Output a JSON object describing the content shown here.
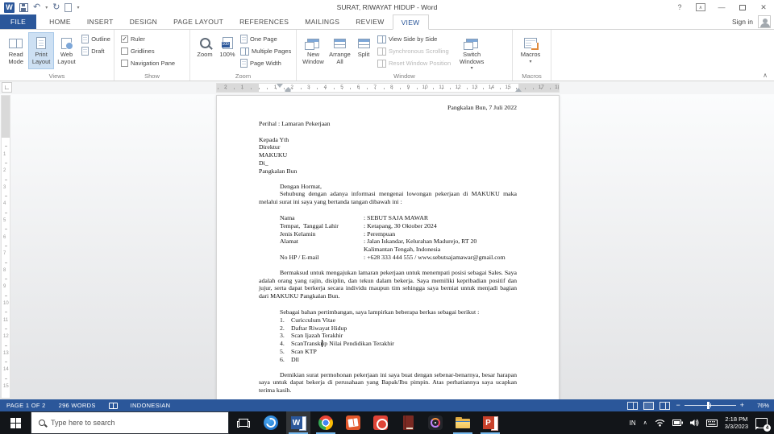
{
  "title_bar": {
    "title": "SURAT, RIWAYAT HIDUP - Word",
    "sign_in": "Sign in"
  },
  "icons": {
    "word_logo": "W",
    "undo": "↶",
    "redo": "↻",
    "qat_dropdown": "▾",
    "help": "?",
    "minimize": "—",
    "close": "✕",
    "check": "✓",
    "dropdown": "▾",
    "collapse_ribbon": "∧",
    "tab_stop": "∟",
    "tray_chevron": "∧"
  },
  "tabs": {
    "items": [
      "FILE",
      "HOME",
      "INSERT",
      "DESIGN",
      "PAGE LAYOUT",
      "REFERENCES",
      "MAILINGS",
      "REVIEW",
      "VIEW"
    ],
    "active": "VIEW"
  },
  "ribbon": {
    "views": {
      "label": "Views",
      "read_mode": "Read Mode",
      "print_layout": "Print Layout",
      "web_layout": "Web Layout",
      "outline": "Outline",
      "draft": "Draft",
      "selected": "Print Layout"
    },
    "show": {
      "label": "Show",
      "ruler": "Ruler",
      "gridlines": "Gridlines",
      "navigation_pane": "Navigation Pane",
      "ruler_checked": true,
      "gridlines_checked": false,
      "navigation_checked": false
    },
    "zoom": {
      "label": "Zoom",
      "zoom": "Zoom",
      "hundred": "100%",
      "one_page": "One Page",
      "multiple_pages": "Multiple Pages",
      "page_width": "Page Width"
    },
    "window": {
      "label": "Window",
      "new_window": "New Window",
      "arrange_all": "Arrange All",
      "split": "Split",
      "side_by_side": "View Side by Side",
      "sync_scrolling": "Synchronous Scrolling",
      "reset_position": "Reset Window Position",
      "switch_windows": "Switch Windows"
    },
    "macros": {
      "label": "Macros",
      "macros": "Macros"
    }
  },
  "ruler": {
    "labels": [
      "2",
      "1",
      "1",
      "2",
      "3",
      "4",
      "5",
      "6",
      "7",
      "8",
      "9",
      "10",
      "11",
      "12",
      "13",
      "14",
      "15",
      "17",
      "18"
    ],
    "units": [
      -2,
      -1,
      1,
      2,
      3,
      4,
      5,
      6,
      7,
      8,
      9,
      10,
      11,
      12,
      13,
      14,
      15,
      17,
      18
    ],
    "v_labels": [
      "1",
      "2",
      "3",
      "4",
      "5",
      "6",
      "7",
      "8",
      "9",
      "10",
      "11",
      "12",
      "13",
      "14",
      "15"
    ]
  },
  "document": {
    "date": "Pangkalan Bun, 7 Juli 2022",
    "subject": "Perihal : Lamaran Pekerjaan",
    "recipient": [
      "Kepada Yth",
      "Direktur",
      "MAKUKU",
      "Di_",
      "Pangkalan Bun"
    ],
    "salutation": "Dengan Hormat,",
    "opening": "Sehubung dengan adanya informasi mengenai lowongan pekerjaan di MAKUKU maka melalui surat ini saya yang bertanda tangan dibawah ini :",
    "details": [
      {
        "label": "Nama",
        "value": ": SEBUT SAJA MAWAR"
      },
      {
        "label": "Tempat,  Tanggal Lahir",
        "value": ": Ketapang, 30 Oktober 2024"
      },
      {
        "label": "Jenis Kelamin",
        "value": ": Perempuan"
      },
      {
        "label": "Alamat",
        "value": ": Jalan Iskandar, Kelurahan Madurejo, RT 20\n Kalimantan Tengah, Indonesia"
      },
      {
        "label": "No HP / E-mail",
        "value": ": +628 333 444 555 / www.sebutsajamawar@gmail.com"
      }
    ],
    "body_paragraph": "Bermaksud untuk mengajukan lamaran pekerjaan untuk menempati posisi sebagai Sales. Saya adalah orang yang rajin, disiplin, dan tekun dalam bekerja. Saya memiliki kepribadian positif dan jujur, serta dapat berkerja secara individu maupun tim sehingga saya berniat untuk menjadi bagian dari MAKUKU Pangkalan Bun.",
    "attachments_intro": "Sebagai bahan pertimbangan, saya lampirkan beberapa berkas sebagai berikut :",
    "attachments": [
      {
        "n": "1.",
        "text": "Curicculum Vitae"
      },
      {
        "n": "2.",
        "text": "Daftar Riwayat Hidup"
      },
      {
        "n": "3.",
        "text": "Scan Ijazah Terakhir"
      },
      {
        "n": "4.",
        "text": "ScanTranskrip Nilai Pendidikan Terakhir"
      },
      {
        "n": "5.",
        "text": "Scan KTP"
      },
      {
        "n": "6.",
        "text": "Dll"
      }
    ],
    "closing": "Demikian surat permohonan pekerjaan ini saya buat dengan sebenar-benarnya, besar harapan saya untuk dapat bekerja di perusahaan yang Bapak/Ibu pimpin. Atas perhatiannya saya ucapkan terima kasih."
  },
  "status_bar": {
    "page": "PAGE 1 OF 2",
    "words": "296 WORDS",
    "language": "INDONESIAN",
    "zoom": "76%"
  },
  "taskbar": {
    "search_placeholder": "Type here to search",
    "tray": {
      "language": "IN",
      "time": "2:18 PM",
      "date": "3/3/2023",
      "badge": "4"
    }
  },
  "colors": {
    "accent_blue": "#2b579a",
    "selected_button": "#cde0f3",
    "taskbar_bg": "#121519",
    "underline_open_app": "#76b9ed"
  }
}
